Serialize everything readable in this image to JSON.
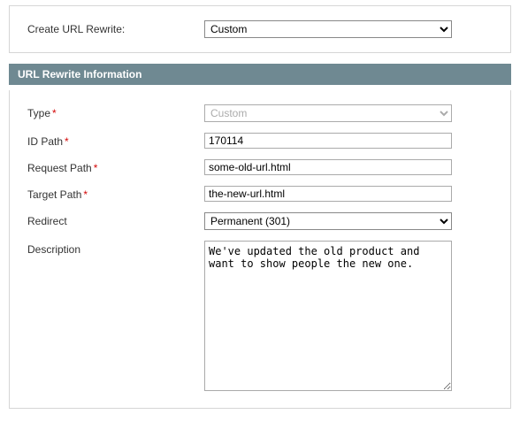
{
  "top": {
    "label": "Create URL Rewrite:",
    "options": [
      "Custom"
    ],
    "value": "Custom"
  },
  "section": {
    "title": "URL Rewrite Information"
  },
  "fields": {
    "type": {
      "label": "Type",
      "required": true,
      "value": "Custom",
      "options": [
        "Custom"
      ]
    },
    "id_path": {
      "label": "ID Path",
      "required": true,
      "value": "170114"
    },
    "request_path": {
      "label": "Request Path",
      "required": true,
      "value": "some-old-url.html"
    },
    "target_path": {
      "label": "Target Path",
      "required": true,
      "value": "the-new-url.html"
    },
    "redirect": {
      "label": "Redirect",
      "required": false,
      "value": "Permanent (301)",
      "options": [
        "Permanent (301)"
      ]
    },
    "description": {
      "label": "Description",
      "required": false,
      "value": "We've updated the old product and want to show people the new one."
    }
  },
  "required_marker": "*"
}
